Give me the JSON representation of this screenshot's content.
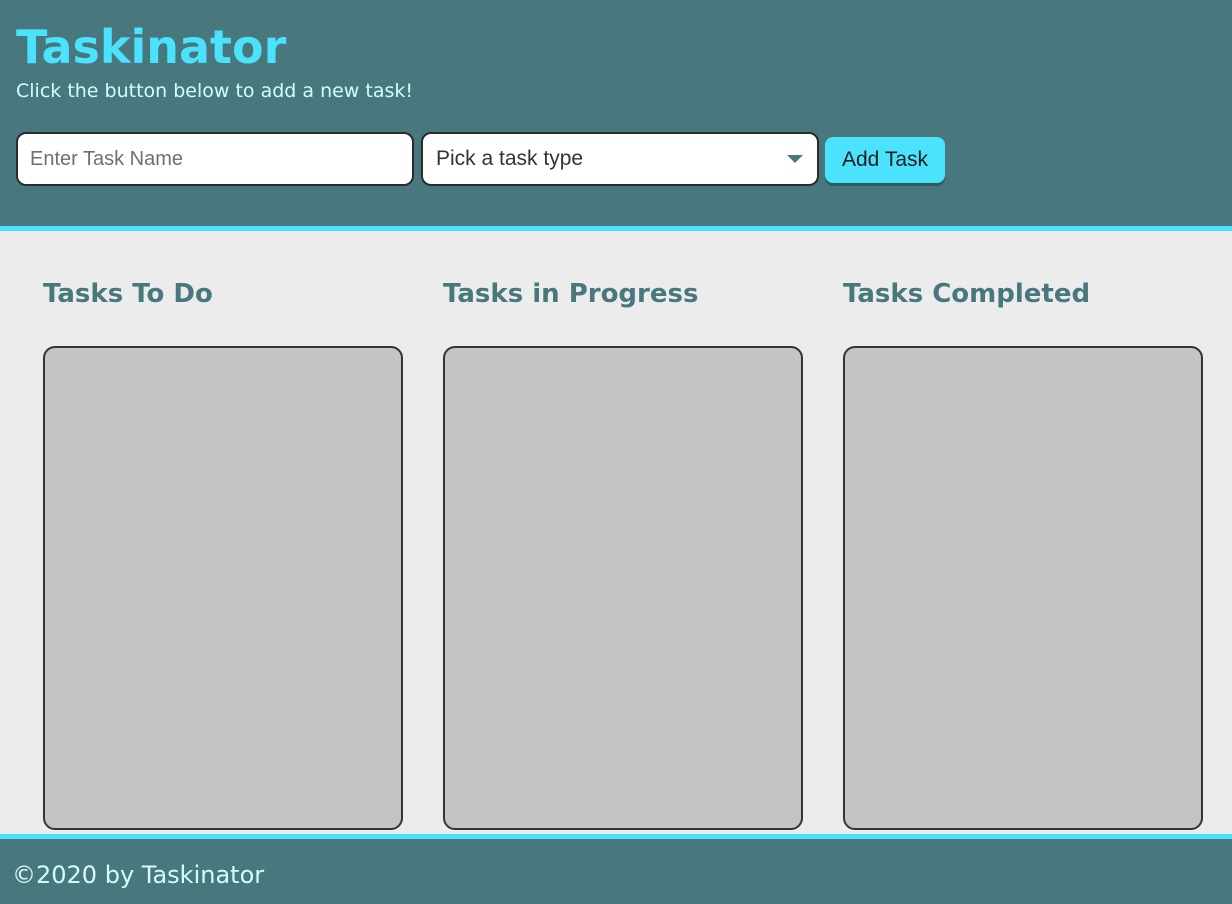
{
  "header": {
    "title": "Taskinator",
    "subtitle": "Click the button below to add a new task!"
  },
  "form": {
    "task_name_placeholder": "Enter Task Name",
    "task_type_selected": "Pick a task type",
    "add_button_label": "Add Task"
  },
  "columns": [
    {
      "title": "Tasks To Do",
      "tasks": []
    },
    {
      "title": "Tasks in Progress",
      "tasks": []
    },
    {
      "title": "Tasks Completed",
      "tasks": []
    }
  ],
  "footer": {
    "text": "©2020 by Taskinator"
  },
  "colors": {
    "header_bg": "#48787e",
    "accent": "#4ae2fc",
    "body_bg": "#ececec",
    "list_bg": "#c4c4c4"
  },
  "icons": {
    "select_arrow": "chevron-down-icon"
  }
}
